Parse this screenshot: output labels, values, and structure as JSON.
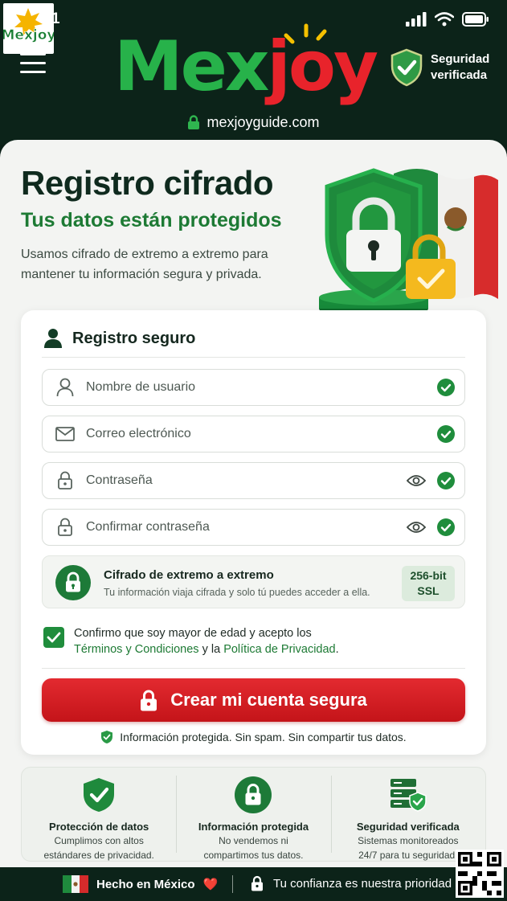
{
  "status_bar": {
    "time": "1"
  },
  "header": {
    "logo_text": "Mexjoy",
    "brand_mex": "Mex",
    "brand_joy": "joy",
    "verified_line1": "Seguridad",
    "verified_line2": "verificada",
    "domain": "mexjoyguide.com"
  },
  "hero": {
    "title": "Registro cifrado",
    "subtitle": "Tus datos están protegidos",
    "description": "Usamos cifrado de extremo a extremo para mantener tu información segura y privada."
  },
  "form": {
    "heading": "Registro seguro",
    "fields": [
      {
        "placeholder": "Nombre de usuario"
      },
      {
        "placeholder": "Correo electrónico"
      },
      {
        "placeholder": "Contraseña"
      },
      {
        "placeholder": "Confirmar contraseña"
      }
    ],
    "encryption": {
      "title": "Cifrado de extremo a extremo",
      "description": "Tu información viaja cifrada y solo tú puedes acceder a ella.",
      "badge_line1": "256-bit",
      "badge_line2": "SSL"
    },
    "terms": {
      "text_before": "Confirmo que soy mayor de edad y acepto los",
      "terms_link": "Términos y Condiciones",
      "text_middle": "y la",
      "privacy_link": "Política de Privacidad",
      "text_after": ".",
      "checked": true
    },
    "submit_label": "Crear mi cuenta segura",
    "privacy_note": "Información protegida. Sin spam. Sin compartir tus datos."
  },
  "features": [
    {
      "title": "Protección de datos",
      "line1": "Cumplimos con altos",
      "line2": "estándares de privacidad."
    },
    {
      "title": "Información protegida",
      "line1": "No vendemos ni",
      "line2": "compartimos tus datos."
    },
    {
      "title": "Seguridad verificada",
      "line1": "Sistemas monitoreados",
      "line2": "24/7 para tu seguridad."
    }
  ],
  "footer": {
    "made_in": "Hecho en México",
    "heart": "❤️",
    "trust": "Tu confianza es nuestra prioridad"
  },
  "colors": {
    "dark_green": "#0c2319",
    "brand_green": "#27b24a",
    "brand_red": "#e8232b",
    "accent_green": "#1d7a34",
    "cta_red": "#d61e24"
  }
}
